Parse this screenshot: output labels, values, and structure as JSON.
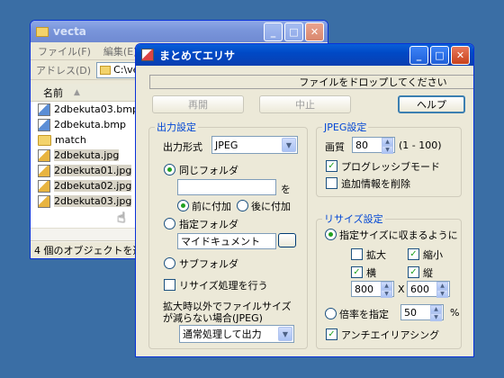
{
  "explorer": {
    "title": "vecta",
    "menu": [
      "ファイル(F)",
      "編集(E)"
    ],
    "address_label": "アドレス(D)",
    "address_value": "C:\\vecta",
    "column_name": "名前",
    "files": [
      {
        "name": "2dbekuta03.bmp",
        "type": "bmp"
      },
      {
        "name": "2dbekuta.bmp",
        "type": "bmp"
      },
      {
        "name": "match",
        "type": "folder"
      },
      {
        "name": "2dbekuta.jpg",
        "type": "jpg"
      },
      {
        "name": "2dbekuta01.jpg",
        "type": "jpg"
      },
      {
        "name": "2dbekuta02.jpg",
        "type": "jpg"
      },
      {
        "name": "2dbekuta03.jpg",
        "type": "jpg"
      }
    ],
    "status": "4 個のオブジェクトを選択 21"
  },
  "dialog": {
    "title": "まとめてエリサ",
    "drop_text": "ファイルをドロップしてください",
    "buttons": {
      "resume": "再開",
      "stop": "中止",
      "help": "ヘルプ"
    },
    "output": {
      "legend": "出力設定",
      "format_label": "出力形式",
      "format_value": "JPEG",
      "same_folder": "同じフォルダ",
      "suffix_label": "を",
      "prefix_add": "前に付加",
      "postfix_add": "後に付加",
      "specified_folder": "指定フォルダ",
      "folder_value": "マイドキュメント",
      "subfolder": "サブフォルダ",
      "resize_process": "リサイズ処理を行う",
      "note_line1": "拡大時以外でファイルサイズ",
      "note_line2": "が減らない場合(JPEG)",
      "normal_value": "通常処理して出力"
    },
    "jpeg": {
      "legend": "JPEG設定",
      "quality_label": "画質",
      "quality_value": "80",
      "quality_range": "(1 - 100)",
      "progressive": "プログレッシブモード",
      "remove_info": "追加情報を削除"
    },
    "resize": {
      "legend": "リサイズ設定",
      "fit_size": "指定サイズに収まるように",
      "enlarge": "拡大",
      "shrink": "縮小",
      "width_label": "横",
      "height_label": "縦",
      "width_value": "800",
      "times": "X",
      "height_value": "600",
      "scale_label": "倍率を指定",
      "scale_value": "50",
      "percent": "%",
      "antialias": "アンチエイリアシング"
    }
  },
  "colors": {
    "desktop": "#3a6ea5",
    "titlebar": "#0049c6",
    "dialog_bg": "#ece9d8",
    "legend": "#0046d5",
    "check": "#21a121"
  }
}
